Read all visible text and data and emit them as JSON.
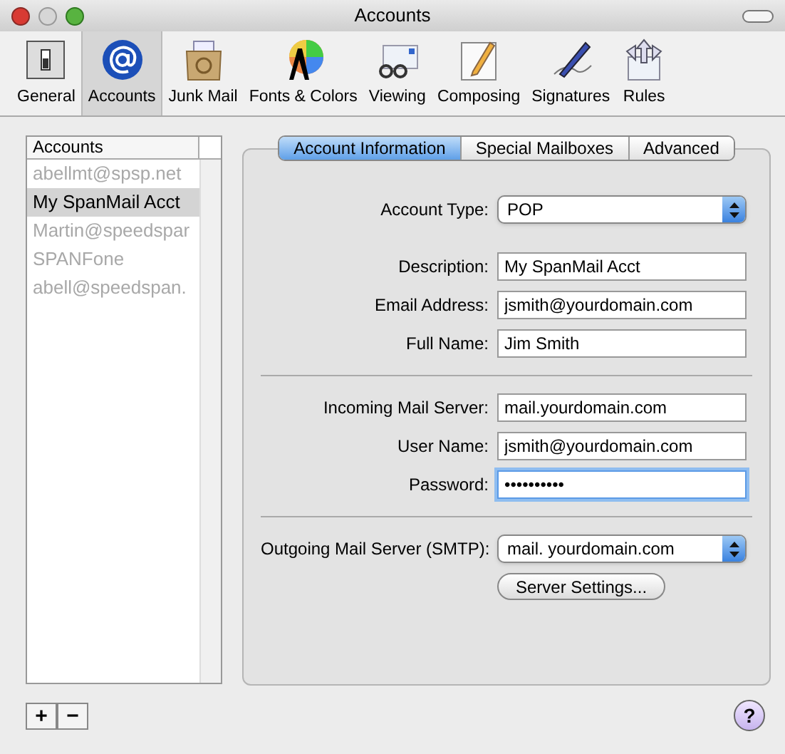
{
  "window": {
    "title": "Accounts"
  },
  "toolbar": [
    {
      "label": "General",
      "selected": false
    },
    {
      "label": "Accounts",
      "selected": true
    },
    {
      "label": "Junk Mail",
      "selected": false
    },
    {
      "label": "Fonts & Colors",
      "selected": false
    },
    {
      "label": "Viewing",
      "selected": false
    },
    {
      "label": "Composing",
      "selected": false
    },
    {
      "label": "Signatures",
      "selected": false
    },
    {
      "label": "Rules",
      "selected": false
    }
  ],
  "accounts": {
    "heading": "Accounts",
    "items": [
      {
        "name": "abellmt@spsp.net",
        "selected": false,
        "faded": true
      },
      {
        "name": "My SpanMail Acct",
        "selected": true,
        "faded": false
      },
      {
        "name": "Martin@speedspar",
        "selected": false,
        "faded": true
      },
      {
        "name": "SPANFone",
        "selected": false,
        "faded": true
      },
      {
        "name": "abell@speedspan.",
        "selected": false,
        "faded": true
      }
    ]
  },
  "list_buttons": [
    "+",
    "−"
  ],
  "tabs": [
    {
      "label": "Account Information",
      "selected": true
    },
    {
      "label": "Special Mailboxes",
      "selected": false
    },
    {
      "label": "Advanced",
      "selected": false
    }
  ],
  "sections": [
    {
      "divider_above": false,
      "fields": [
        {
          "kind": "select",
          "label": "Account Type:",
          "value": "POP"
        }
      ]
    },
    {
      "divider_above": false,
      "fields": [
        {
          "kind": "text",
          "label": "Description:",
          "value": "My SpanMail Acct",
          "focused": false
        },
        {
          "kind": "text",
          "label": "Email Address:",
          "value": "jsmith@yourdomain.com",
          "focused": false
        },
        {
          "kind": "text",
          "label": "Full Name:",
          "value": "Jim Smith",
          "focused": false
        }
      ]
    },
    {
      "divider_above": true,
      "fields": [
        {
          "kind": "text",
          "label": "Incoming Mail Server:",
          "value": "mail.yourdomain.com",
          "focused": false
        },
        {
          "kind": "text",
          "label": "User Name:",
          "value": "jsmith@yourdomain.com",
          "focused": false
        },
        {
          "kind": "text",
          "label": "Password:",
          "value": "••••••••••",
          "focused": true
        }
      ]
    },
    {
      "divider_above": true,
      "fields": [
        {
          "kind": "select",
          "label": "Outgoing Mail Server (SMTP):",
          "value": "mail. yourdomain.com"
        }
      ]
    }
  ],
  "server_settings_button": "Server Settings...",
  "help_button": "?"
}
